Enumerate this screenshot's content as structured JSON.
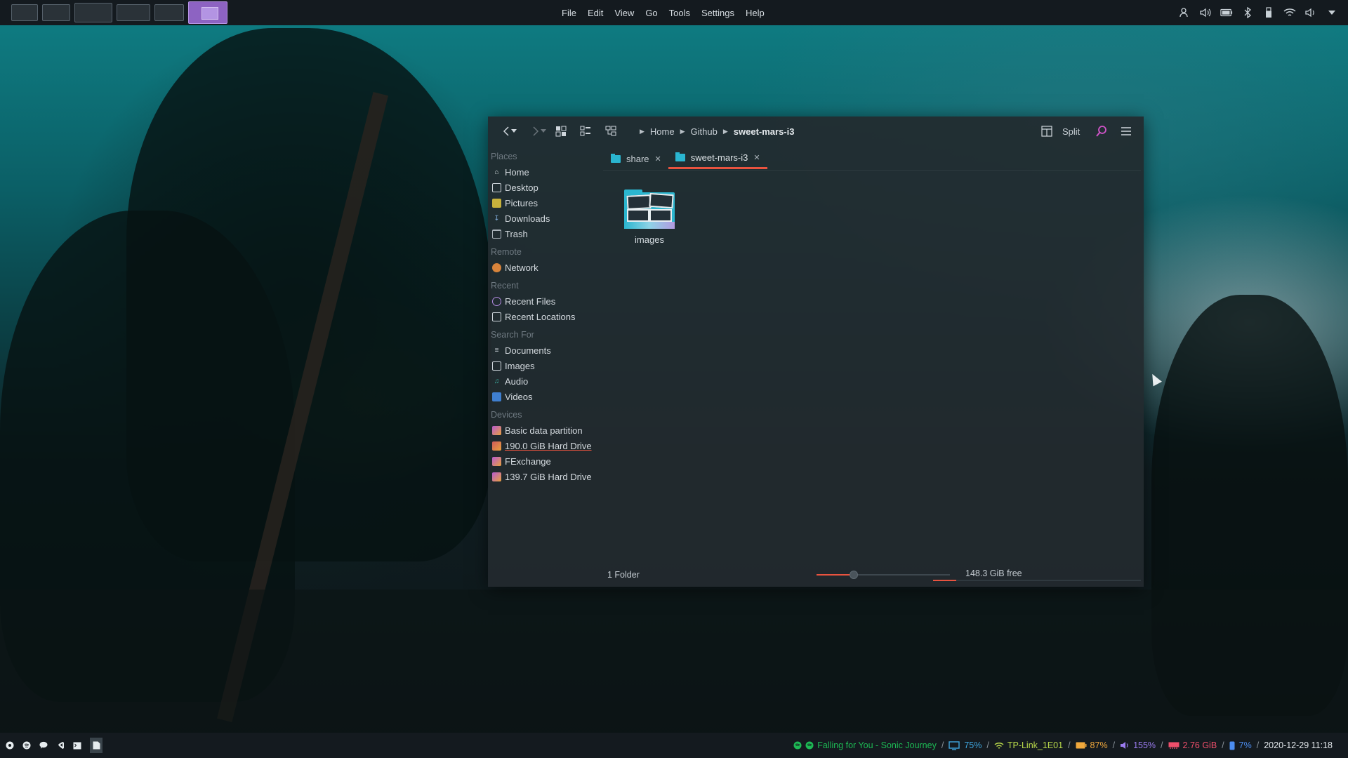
{
  "topbar": {
    "menu": [
      "File",
      "Edit",
      "View",
      "Go",
      "Tools",
      "Settings",
      "Help"
    ],
    "workspaces": [
      {
        "name": "workspace-1",
        "active": false
      },
      {
        "name": "workspace-2",
        "active": false
      },
      {
        "name": "workspace-3",
        "active": false
      },
      {
        "name": "workspace-4",
        "active": false
      },
      {
        "name": "workspace-5",
        "active": false
      },
      {
        "name": "workspace-6",
        "active": true
      }
    ],
    "tray_icons": [
      "user-switch-icon",
      "volume-icon",
      "battery-icon",
      "bluetooth-icon",
      "usb-icon",
      "wifi-icon",
      "audio-icon",
      "chevron-down-icon"
    ]
  },
  "window": {
    "breadcrumb": [
      "Home",
      "Github",
      "sweet-mars-i3"
    ],
    "split_label": "Split",
    "tabs": [
      {
        "label": "share",
        "active": false
      },
      {
        "label": "sweet-mars-i3",
        "active": true
      }
    ],
    "sidebar": {
      "places_header": "Places",
      "places": [
        "Home",
        "Desktop",
        "Pictures",
        "Downloads",
        "Trash"
      ],
      "remote_header": "Remote",
      "remote": [
        "Network"
      ],
      "recent_header": "Recent",
      "recent": [
        "Recent Files",
        "Recent Locations"
      ],
      "search_header": "Search For",
      "search": [
        "Documents",
        "Images",
        "Audio",
        "Videos"
      ],
      "devices_header": "Devices",
      "devices": [
        "Basic data partition",
        "190.0 GiB Hard Drive",
        "FExchange",
        "139.7 GiB Hard Drive"
      ]
    },
    "files": [
      {
        "name": "images",
        "type": "folder"
      }
    ],
    "status": {
      "summary": "1 Folder",
      "free_space": "148.3 GiB free",
      "zoom_level": 0.28,
      "disk_used_fraction": 0.11
    }
  },
  "bottombar": {
    "launchers": [
      "power-icon",
      "spotify-icon",
      "chat-icon",
      "vscode-icon",
      "terminal-icon",
      "files-icon"
    ],
    "music": "Falling for You - Sonic Journey",
    "brightness": "75%",
    "wifi": "TP-Link_1E01",
    "battery": "87%",
    "volume": "155%",
    "memory": "2.76 GiB",
    "cpu": "7%",
    "datetime": "2020-12-29 11:18"
  },
  "colors": {
    "accent": "#e8533f",
    "folder": "#2ab5d0",
    "workspace_active": "#8d63c2",
    "music": "#1db954",
    "brightness": "#3fa7e0",
    "wifi": "#b9d94a",
    "battery": "#f0a83c",
    "volume": "#9b7cf0",
    "memory": "#ef4f6b",
    "cpu": "#4c8df0"
  }
}
